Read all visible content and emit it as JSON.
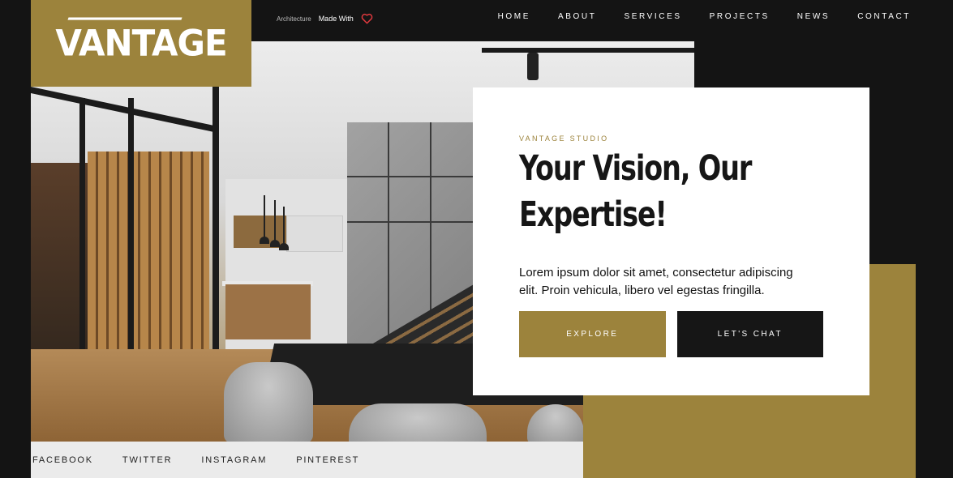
{
  "brand": {
    "logo_text": "VANTAGE",
    "accent": "#9c833c",
    "dark": "#141414"
  },
  "topbar": {
    "tag_small": "Architecture",
    "tag_made": "Made With",
    "heart_icon": "heart-icon"
  },
  "nav": {
    "items": [
      "HOME",
      "ABOUT",
      "SERVICES",
      "PROJECTS",
      "NEWS",
      "CONTACT"
    ]
  },
  "hero": {
    "eyebrow": "VANTAGE STUDIO",
    "headline": "Your Vision, Our Expertise!",
    "body": "Lorem ipsum dolor sit amet, consectetur adipiscing elit. Proin vehicula, libero vel egestas fringilla.",
    "primary_button": "EXPLORE",
    "secondary_button": "LET'S CHAT"
  },
  "social": {
    "links": [
      "FACEBOOK",
      "TWITTER",
      "INSTAGRAM",
      "PINTEREST"
    ]
  }
}
